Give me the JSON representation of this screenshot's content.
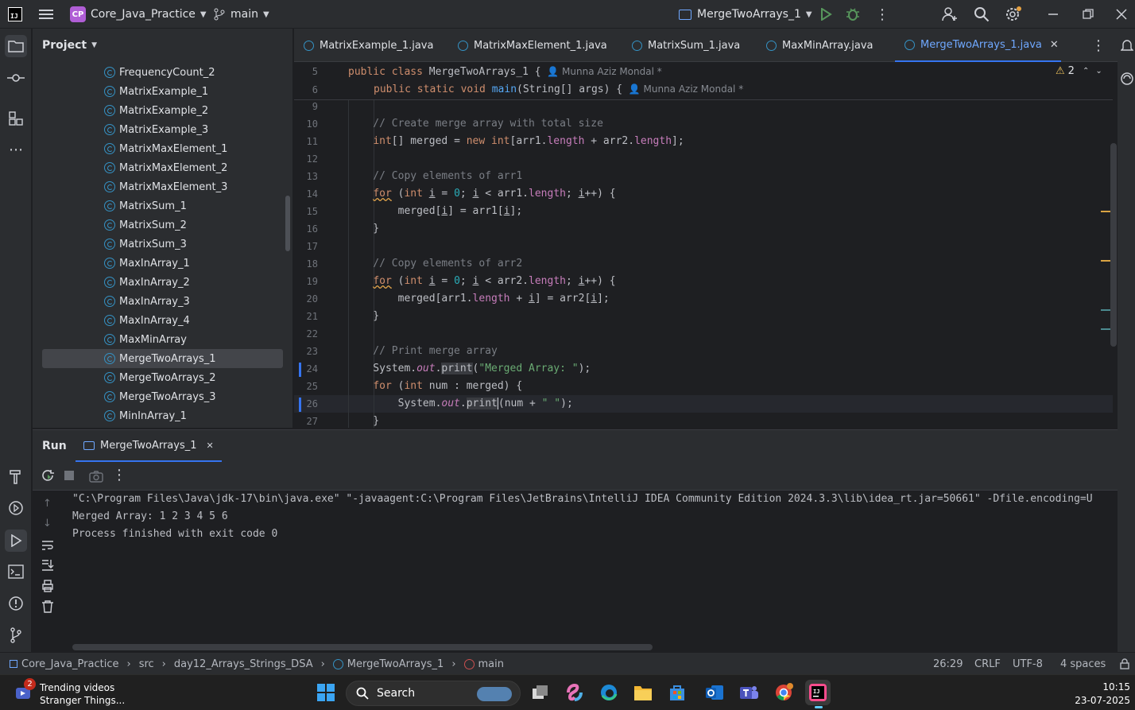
{
  "titlebar": {
    "project_badge": "CP",
    "project_name": "Core_Java_Practice",
    "branch": "main",
    "run_config": "MergeTwoArrays_1"
  },
  "project_panel": {
    "title": "Project",
    "items": [
      {
        "label": "FrequencyCount_2"
      },
      {
        "label": "MatrixExample_1"
      },
      {
        "label": "MatrixExample_2"
      },
      {
        "label": "MatrixExample_3"
      },
      {
        "label": "MatrixMaxElement_1"
      },
      {
        "label": "MatrixMaxElement_2"
      },
      {
        "label": "MatrixMaxElement_3"
      },
      {
        "label": "MatrixSum_1"
      },
      {
        "label": "MatrixSum_2"
      },
      {
        "label": "MatrixSum_3"
      },
      {
        "label": "MaxInArray_1"
      },
      {
        "label": "MaxInArray_2"
      },
      {
        "label": "MaxInArray_3"
      },
      {
        "label": "MaxInArray_4"
      },
      {
        "label": "MaxMinArray"
      },
      {
        "label": "MergeTwoArrays_1"
      },
      {
        "label": "MergeTwoArrays_2"
      },
      {
        "label": "MergeTwoArrays_3"
      },
      {
        "label": "MinInArray_1"
      }
    ],
    "selected": "MergeTwoArrays_1"
  },
  "tabs": [
    {
      "label": "MatrixExample_1.java"
    },
    {
      "label": "MatrixMaxElement_1.java"
    },
    {
      "label": "MatrixSum_1.java"
    },
    {
      "label": "MaxMinArray.java"
    },
    {
      "label": "MergeTwoArrays_1.java"
    }
  ],
  "editor": {
    "warnings": "2",
    "author": "Munna Aziz Mondal *",
    "sticky": [
      {
        "ln": "5",
        "text": "public class MergeTwoArrays_1 {"
      },
      {
        "ln": "6",
        "text": "public static void main(String[] args) {"
      }
    ],
    "line_numbers": [
      "9",
      "10",
      "11",
      "12",
      "13",
      "14",
      "15",
      "16",
      "17",
      "18",
      "19",
      "20",
      "21",
      "22",
      "23",
      "24",
      "25",
      "26",
      "27"
    ],
    "code": {
      "l10": "// Create merge array with total size",
      "l13": "// Copy elements of arr1",
      "l18": "// Copy elements of arr2",
      "l23": "// Print merge array"
    }
  },
  "run": {
    "title": "Run",
    "tab": "MergeTwoArrays_1",
    "output": [
      "\"C:\\Program Files\\Java\\jdk-17\\bin\\java.exe\" \"-javaagent:C:\\Program Files\\JetBrains\\IntelliJ IDEA Community Edition 2024.3.3\\lib\\idea_rt.jar=50661\" -Dfile.encoding=U",
      "Merged Array: 1 2 3 4 5 6",
      "Process finished with exit code 0"
    ]
  },
  "statusbar": {
    "crumbs": [
      "Core_Java_Practice",
      "src",
      "day12_Arrays_Strings_DSA",
      "MergeTwoArrays_1",
      "main"
    ],
    "position": "26:29",
    "line_sep": "CRLF",
    "encoding": "UTF-8",
    "indent": "4 spaces"
  },
  "taskbar": {
    "news_badge": "2",
    "news_title": "Trending videos",
    "news_sub": "Stranger Things...",
    "search_label": "Search",
    "time": "10:15",
    "date": "23-07-2025"
  }
}
